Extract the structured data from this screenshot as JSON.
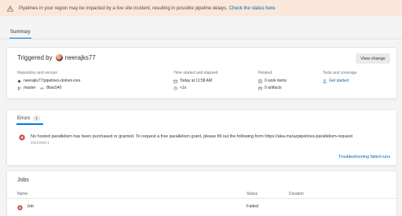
{
  "banner": {
    "message": "Pipelines in your region may be impacted by a live site incident, resulting in possible pipeline delays.",
    "link": "Check the status here."
  },
  "tabs": {
    "summary": "Summary"
  },
  "summary": {
    "triggered_prefix": "Triggered by",
    "user": "neerajks77",
    "view_change": "View change",
    "repository": {
      "label": "Repository and version",
      "repo": "neerajks77/pipelines-dotnet-core",
      "branch": "master",
      "commit": "8bac540"
    },
    "time": {
      "label": "Time started and elapsed",
      "started": "Today at 11:58 AM",
      "elapsed": "<1s"
    },
    "related": {
      "label": "Related",
      "work_items": "0 work items",
      "artifacts": "0 artifacts"
    },
    "tests": {
      "label": "Tests and coverage",
      "link": "Get started"
    }
  },
  "errors": {
    "tab_label": "Errors",
    "count": "1",
    "message": "No hosted parallelism has been purchased or granted. To request a free parallelism grant, please fill out the following form https://aka.ms/azpipelines-parallelism-request",
    "date": "20210620.1",
    "troubleshoot_link": "Troubleshooting failed runs"
  },
  "jobs": {
    "title": "Jobs",
    "columns": {
      "name": "Name",
      "status": "Status",
      "duration": "Duration"
    },
    "rows": [
      {
        "name": "Job",
        "status": "Failed",
        "duration": ""
      }
    ]
  },
  "colors": {
    "accent": "#0078d4",
    "link": "#0063b1",
    "error": "#cd4a45",
    "banner_bg": "#fbe8dc"
  }
}
